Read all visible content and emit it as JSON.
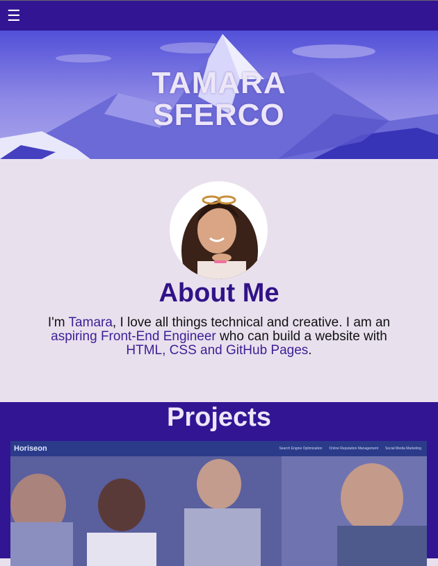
{
  "nav": {
    "menu_icon": "☰"
  },
  "hero": {
    "title_line1": "TAMARA",
    "title_line2": "SFERCO"
  },
  "about": {
    "heading": "About Me",
    "text_1": "I'm ",
    "name": "Tamara",
    "text_2": ", I love all things technical and creative. I am an ",
    "role": "aspiring Front-End Engineer",
    "text_3": " who can build a website with ",
    "skills": "HTML, CSS and GitHub Pages",
    "text_4": "."
  },
  "projects": {
    "heading": "Projects",
    "card": {
      "logo": "Horiseon",
      "links": [
        "Search Engine Optimization",
        "Online Reputation Management",
        "Social Media Marketing"
      ]
    }
  },
  "colors": {
    "nav_bg": "#321593",
    "accent_text": "#301387",
    "page_bg": "#e9e0ee",
    "projects_bg": "#321593"
  }
}
